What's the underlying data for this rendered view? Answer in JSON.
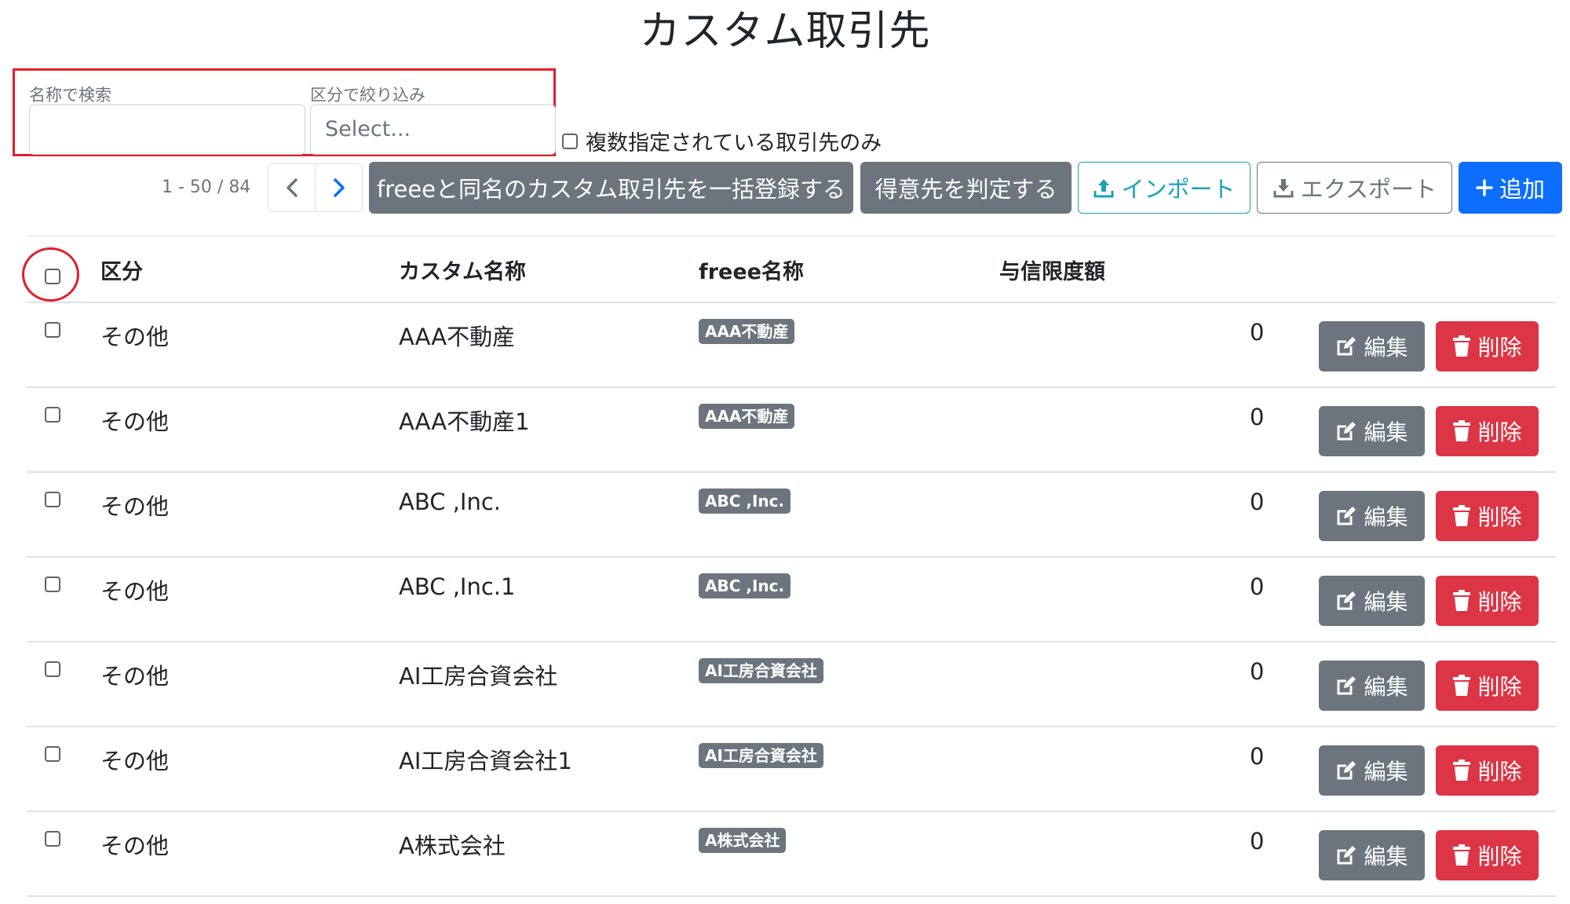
{
  "title": "カスタム取引先",
  "filters": {
    "search_label": "名称で検索",
    "search_value": "",
    "category_label": "区分で絞り込み",
    "category_placeholder": "Select..."
  },
  "multi_checkbox_label": "複数指定されている取引先のみ",
  "pagination": {
    "range": "1 - 50 / 84"
  },
  "buttons": {
    "bulk_register": "freeeと同名のカスタム取引先を一括登録する",
    "judge_customer": "得意先を判定する",
    "import": "インポート",
    "export": "エクスポート",
    "add": "追加"
  },
  "table": {
    "headers": [
      "区分",
      "カスタム名称",
      "freee名称",
      "与信限度額"
    ],
    "rows": [
      {
        "category": "その他",
        "custom_name": "AAA不動産",
        "freee_name": "AAA不動産",
        "credit_limit": "0"
      },
      {
        "category": "その他",
        "custom_name": "AAA不動産1",
        "freee_name": "AAA不動産",
        "credit_limit": "0"
      },
      {
        "category": "その他",
        "custom_name": "ABC ,Inc.",
        "freee_name": "ABC ,Inc.",
        "credit_limit": "0"
      },
      {
        "category": "その他",
        "custom_name": "ABC ,Inc.1",
        "freee_name": "ABC ,Inc.",
        "credit_limit": "0"
      },
      {
        "category": "その他",
        "custom_name": "AI工房合資会社",
        "freee_name": "AI工房合資会社",
        "credit_limit": "0"
      },
      {
        "category": "その他",
        "custom_name": "AI工房合資会社1",
        "freee_name": "AI工房合資会社",
        "credit_limit": "0"
      },
      {
        "category": "その他",
        "custom_name": "A株式会社",
        "freee_name": "A株式会社",
        "credit_limit": "0"
      }
    ],
    "edit_label": "編集",
    "delete_label": "削除"
  },
  "colors": {
    "primary": "#0d6efd",
    "secondary": "#6c757d",
    "danger": "#dc3545",
    "info": "#17a2b8",
    "highlight": "#e01f2a"
  },
  "icons": {
    "prev": "chevron-left-icon",
    "next": "chevron-right-icon",
    "import": "upload-icon",
    "export": "download-icon",
    "add": "plus-icon",
    "edit": "edit-icon",
    "delete": "trash-icon"
  }
}
